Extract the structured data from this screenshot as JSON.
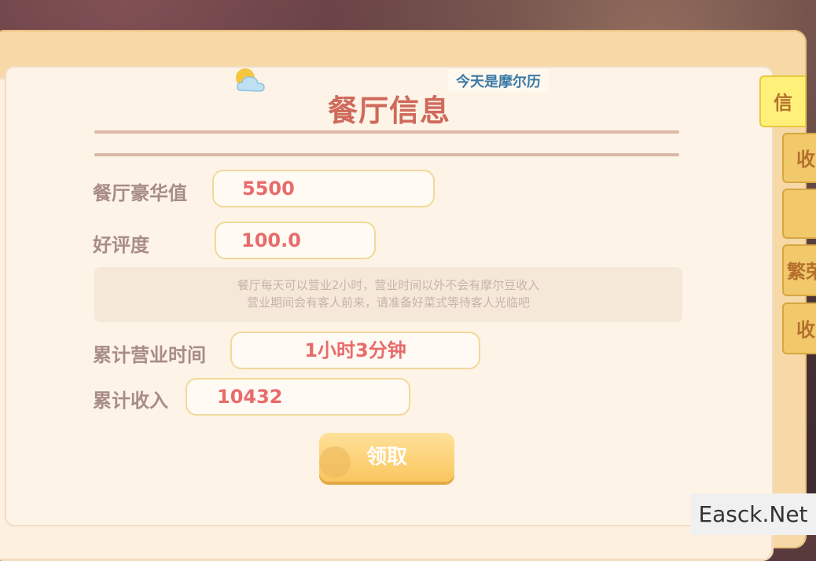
{
  "header": {
    "title": "餐厅信息",
    "date_text": "今天是摩尔历"
  },
  "stats": {
    "luxury_label": "餐厅豪华值",
    "luxury_value": "5500",
    "rating_label": "好评度",
    "rating_value": "100.0",
    "notice_line1": "餐厅每天可以营业2小时，营业时间以外不会有摩尔豆收入",
    "notice_line2": "营业期间会有客人前来，请准备好菜式等待客人光临吧",
    "time_label": "累计营业时间",
    "time_value": "1小时3分钟",
    "income_label": "累计收入",
    "income_value": "10432"
  },
  "claim_button": "领取",
  "side_tabs": [
    "信",
    "收",
    "",
    "繁荣",
    "收"
  ],
  "watermark": "Easck.Net",
  "colors": {
    "title": "#cf6a5c",
    "value": "#e86b6b",
    "label": "#a88c86",
    "date": "#3c7aa6",
    "button": "#f9c65f"
  },
  "icons": [
    "weather-sun-cloud-icon",
    "coin-icon"
  ]
}
